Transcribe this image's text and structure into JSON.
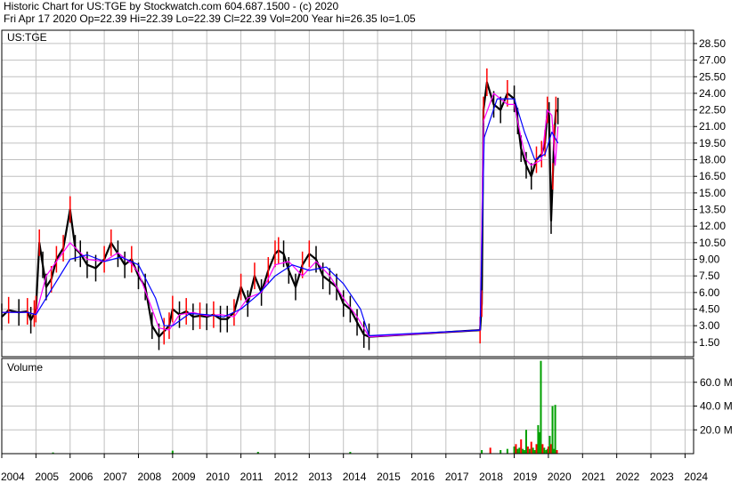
{
  "header": {
    "line1": "Historic Chart for US:TGE by Stockwatch.com 604.687.1500 - (c) 2020",
    "line2": "Fri Apr 17 2020  Op=22.39  Hi=22.39  Lo=22.39  Cl=22.39  Vol=200  Year hi=26.35  lo=1.05"
  },
  "colors": {
    "background": "#ffffff",
    "grid": "#c0c0c0",
    "axis": "#000000",
    "price_bar": "#000000",
    "up_bar": "#ff0000",
    "ma_fast": "#ff00ff",
    "ma_slow": "#0000ff",
    "volume_green": "#00a000",
    "volume_red": "#ff0000"
  },
  "chart_data": [
    {
      "type": "line",
      "panel": "price",
      "label": "US:TGE",
      "grid": true,
      "y_ticks": [
        "1.50",
        "3.00",
        "4.50",
        "6.00",
        "7.50",
        "9.00",
        "10.50",
        "12.00",
        "13.50",
        "15.00",
        "16.50",
        "18.00",
        "19.50",
        "21.00",
        "22.50",
        "24.00",
        "25.50",
        "27.00",
        "28.50"
      ],
      "ylim": [
        0.2,
        29.7
      ],
      "x_ticks": [
        "2004",
        "2005",
        "2006",
        "2007",
        "2008",
        "2009",
        "2010",
        "2011",
        "2012",
        "2013",
        "2014",
        "2015",
        "2016",
        "2017",
        "2018",
        "2019",
        "2020",
        "2021",
        "2022",
        "2023",
        "2024"
      ],
      "xlim": [
        2004.0,
        2024.25
      ],
      "series": [
        {
          "name": "",
          "style": "price",
          "x": [
            2004.0,
            2004.2,
            2004.5,
            2004.75,
            2004.85,
            2004.95,
            2005.0,
            2005.1,
            2005.2,
            2005.3,
            2005.45,
            2005.6,
            2005.8,
            2006.0,
            2006.15,
            2006.3,
            2006.5,
            2006.75,
            2007.0,
            2007.2,
            2007.4,
            2007.6,
            2007.8,
            2008.0,
            2008.2,
            2008.4,
            2008.6,
            2008.75,
            2008.9,
            2009.0,
            2009.2,
            2009.4,
            2009.6,
            2009.8,
            2010.0,
            2010.2,
            2010.4,
            2010.6,
            2010.8,
            2011.0,
            2011.2,
            2011.4,
            2011.6,
            2011.8,
            2012.0,
            2012.1,
            2012.25,
            2012.4,
            2012.6,
            2012.8,
            2013.0,
            2013.2,
            2013.4,
            2013.6,
            2013.8,
            2014.0,
            2014.2,
            2014.4,
            2014.6,
            2014.75,
            2018.0,
            2018.05,
            2018.1,
            2018.2,
            2018.4,
            2018.6,
            2018.8,
            2019.0,
            2019.1,
            2019.2,
            2019.35,
            2019.5,
            2019.65,
            2019.8,
            2019.9,
            2019.97,
            2020.02,
            2020.08,
            2020.13,
            2020.17,
            2020.22,
            2020.28
          ],
          "y": [
            3.8,
            4.4,
            4.2,
            4.3,
            3.5,
            4.1,
            4.5,
            10.5,
            8.5,
            6.5,
            7.2,
            9.0,
            10.0,
            13.5,
            10.0,
            9.5,
            8.5,
            8.2,
            9.0,
            10.5,
            9.5,
            8.5,
            9.0,
            7.5,
            6.5,
            3.0,
            2.0,
            2.5,
            3.0,
            4.5,
            4.0,
            4.3,
            3.8,
            3.9,
            3.8,
            4.0,
            3.6,
            3.6,
            4.2,
            6.5,
            5.0,
            7.5,
            6.0,
            8.0,
            9.5,
            9.8,
            9.5,
            8.0,
            6.5,
            8.5,
            9.5,
            9.0,
            7.5,
            7.0,
            6.5,
            5.0,
            4.5,
            3.3,
            2.2,
            2.0,
            2.6,
            5.0,
            22.5,
            25.0,
            23.0,
            22.5,
            24.0,
            23.5,
            21.5,
            19.0,
            17.5,
            16.5,
            18.0,
            18.5,
            19.5,
            22.5,
            22.0,
            12.5,
            16.5,
            20.0,
            22.5,
            22.4
          ]
        },
        {
          "name": "",
          "style": "ma_fast",
          "x": [
            2004.0,
            2004.75,
            2005.0,
            2005.3,
            2005.6,
            2006.0,
            2006.5,
            2007.0,
            2007.4,
            2007.8,
            2008.0,
            2008.4,
            2008.6,
            2008.9,
            2009.2,
            2009.6,
            2010.0,
            2010.4,
            2010.8,
            2011.2,
            2011.6,
            2012.0,
            2012.4,
            2012.8,
            2013.2,
            2013.6,
            2014.0,
            2014.4,
            2014.75,
            2018.0,
            2018.1,
            2018.4,
            2018.8,
            2019.0,
            2019.2,
            2019.35,
            2019.5,
            2019.8,
            2019.97,
            2020.1,
            2020.2,
            2020.28
          ],
          "y": [
            4.2,
            4.2,
            4.0,
            7.5,
            8.8,
            10.5,
            9.0,
            8.8,
            9.6,
            8.6,
            7.8,
            4.5,
            2.8,
            2.6,
            4.0,
            4.2,
            3.9,
            4.0,
            3.8,
            5.5,
            6.0,
            8.5,
            8.8,
            7.5,
            8.8,
            7.5,
            5.5,
            3.8,
            2.0,
            2.6,
            21.5,
            24.0,
            23.0,
            23.0,
            20.0,
            18.0,
            17.5,
            18.0,
            22.5,
            22.0,
            17.5,
            21.0
          ]
        },
        {
          "name": "",
          "style": "ma_slow",
          "x": [
            2004.0,
            2004.75,
            2005.0,
            2005.5,
            2006.0,
            2006.5,
            2007.0,
            2007.5,
            2008.0,
            2008.5,
            2008.75,
            2009.0,
            2009.5,
            2010.0,
            2010.5,
            2011.0,
            2011.5,
            2012.0,
            2012.5,
            2013.0,
            2013.5,
            2014.0,
            2014.5,
            2014.75,
            2018.0,
            2018.12,
            2018.5,
            2019.0,
            2019.3,
            2019.6,
            2019.9,
            2020.1,
            2020.28
          ],
          "y": [
            4.2,
            4.2,
            4.0,
            6.5,
            9.0,
            9.4,
            8.8,
            9.2,
            8.5,
            5.5,
            3.0,
            3.0,
            4.1,
            4.0,
            3.8,
            4.5,
            5.8,
            7.5,
            8.5,
            8.0,
            8.3,
            6.8,
            4.5,
            2.1,
            2.6,
            20.0,
            23.5,
            23.5,
            20.5,
            18.0,
            18.5,
            20.5,
            19.5
          ]
        }
      ]
    },
    {
      "type": "bar",
      "panel": "volume",
      "label": "Volume",
      "y_ticks": [
        "20.0 M",
        "40.0 M",
        "60.0 M"
      ],
      "ylim": [
        0,
        80
      ],
      "series": [
        {
          "name": "",
          "x": [
            2005.0,
            2005.5,
            2009.0,
            2011.5,
            2014.2,
            2018.05,
            2018.3,
            2018.6,
            2018.8,
            2019.0,
            2019.05,
            2019.1,
            2019.15,
            2019.2,
            2019.25,
            2019.3,
            2019.35,
            2019.4,
            2019.45,
            2019.5,
            2019.55,
            2019.6,
            2019.65,
            2019.7,
            2019.73,
            2019.78,
            2019.83,
            2019.88,
            2019.93,
            2019.97,
            2020.0,
            2020.04,
            2020.08,
            2020.12,
            2020.16,
            2020.2,
            2020.25
          ],
          "values": [
            0.4,
            1.0,
            2.5,
            1.5,
            1.5,
            3.0,
            5.0,
            3.0,
            4.0,
            6.0,
            8.0,
            4.0,
            5.0,
            12.0,
            4.0,
            3.0,
            20.0,
            6.0,
            4.0,
            10.0,
            5.0,
            3.0,
            8.0,
            24.0,
            18.0,
            78.0,
            8.0,
            5.0,
            3.0,
            4.0,
            6.0,
            15.0,
            8.0,
            40.0,
            4.0,
            41.0,
            3.0
          ],
          "colors": [
            "red",
            "green",
            "green",
            "green",
            "green",
            "green",
            "red",
            "green",
            "green",
            "green",
            "red",
            "green",
            "green",
            "red",
            "green",
            "green",
            "green",
            "red",
            "green",
            "red",
            "green",
            "green",
            "red",
            "green",
            "green",
            "green",
            "red",
            "green",
            "green",
            "green",
            "red",
            "green",
            "red",
            "green",
            "green",
            "green",
            "red"
          ]
        }
      ]
    }
  ]
}
